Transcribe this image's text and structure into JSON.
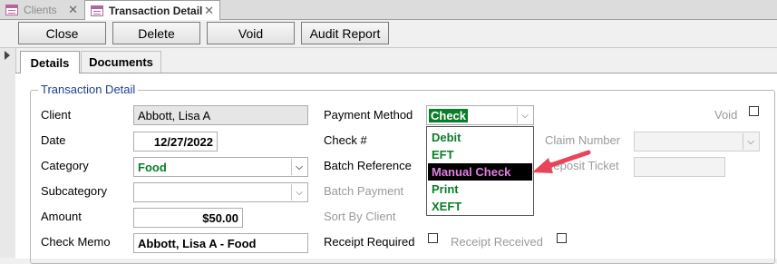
{
  "doc_tabs": [
    {
      "label": "Clients",
      "active": false,
      "icon": "form-icon"
    },
    {
      "label": "Transaction Detail",
      "active": true,
      "icon": "form-icon"
    }
  ],
  "toolbar": {
    "close_label": "Close",
    "delete_label": "Delete",
    "void_label": "Void",
    "audit_report_label": "Audit Report"
  },
  "subtabs": {
    "details": "Details",
    "documents": "Documents"
  },
  "group_title": "Transaction Detail",
  "fields": {
    "client_label": "Client",
    "client_value": "Abbott, Lisa A",
    "date_label": "Date",
    "date_value": "12/27/2022",
    "category_label": "Category",
    "category_value": "Food",
    "subcategory_label": "Subcategory",
    "subcategory_value": "",
    "amount_label": "Amount",
    "amount_value": "$50.00",
    "check_memo_label": "Check Memo",
    "check_memo_value": "Abbott, Lisa A - Food",
    "payment_method_label": "Payment Method",
    "payment_method_value": "Check",
    "check_num_label": "Check #",
    "batch_reference_label": "Batch Reference",
    "batch_payment_label": "Batch Payment",
    "sort_by_client_label": "Sort By Client",
    "receipt_required_label": "Receipt Required",
    "receipt_received_label": "Receipt Received",
    "void_label": "Void",
    "claim_number_label": "Claim Number",
    "deposit_ticket_label": "Deposit Ticket"
  },
  "payment_method_options": [
    "Debit",
    "EFT",
    "Manual Check",
    "Print",
    "XEFT"
  ],
  "highlighted_option": "Manual Check",
  "colors": {
    "accent_green": "#0a7d2a",
    "highlight_text": "#e07fe0",
    "arrow": "#e8455a",
    "group_title": "#1f3f8f"
  }
}
